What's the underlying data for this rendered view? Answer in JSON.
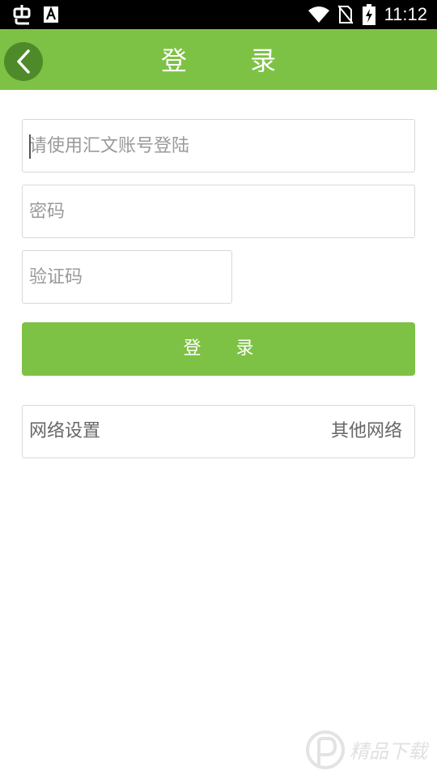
{
  "status_bar": {
    "time": "11:12",
    "icons": [
      "bug-icon",
      "notification-a-icon",
      "wifi-icon",
      "no-sim-icon",
      "battery-charging-icon"
    ]
  },
  "app_bar": {
    "title": "登 录",
    "back_icon": "chevron-left-icon",
    "background_color": "#7dc244"
  },
  "form": {
    "account_placeholder": "请使用汇文账号登陆",
    "account_value": "",
    "password_placeholder": "密码",
    "password_value": "",
    "captcha_placeholder": "验证码",
    "captcha_value": "",
    "login_label": "登 录"
  },
  "network": {
    "settings_label": "网络设置",
    "other_label": "其他网络"
  },
  "watermark": {
    "text": "精品下载",
    "icon": "p-logo-icon"
  }
}
